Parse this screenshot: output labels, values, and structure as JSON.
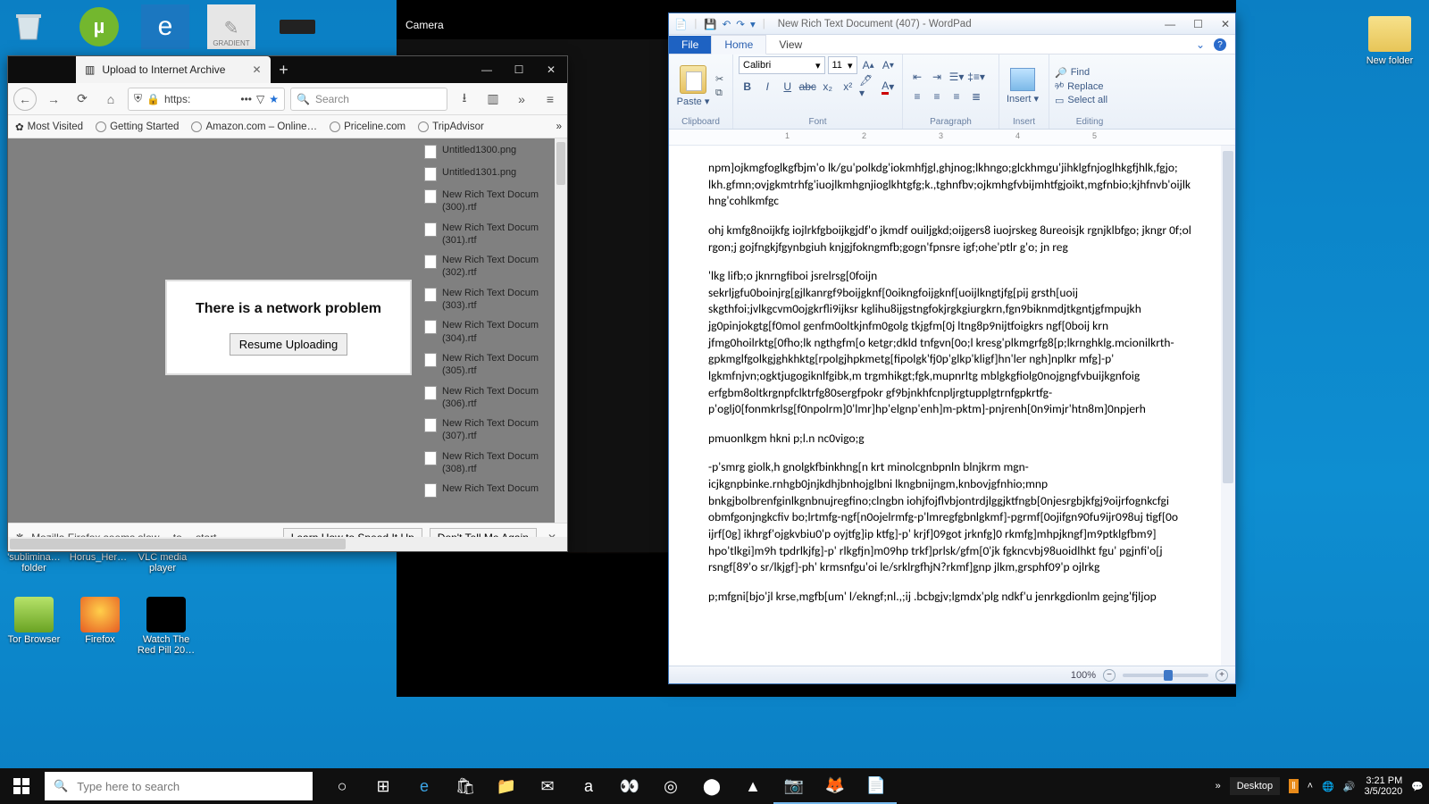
{
  "desktop": {
    "recycle": "Recycle Bin",
    "newfolder": "New folder",
    "row2": [
      "Tor Browser",
      "Firefox",
      "Watch The Red Pill 20…"
    ],
    "row1": [
      "'sublimina… folder",
      "Horus_Her…",
      "VLC media player"
    ],
    "gradient_label": "GRADIENT"
  },
  "camera": {
    "title": "Camera"
  },
  "firefox": {
    "tab": "Upload to Internet Archive",
    "url": "https:",
    "search_placeholder": "Search",
    "bookmarks": [
      "Most Visited",
      "Getting Started",
      "Amazon.com – Online…",
      "Priceline.com",
      "TripAdvisor"
    ],
    "net_h": "There is a network problem",
    "net_btn": "Resume Uploading",
    "files": [
      "Untitled1300.png",
      "Untitled1301.png",
      "New Rich Text Docum (300).rtf",
      "New Rich Text Docum (301).rtf",
      "New Rich Text Docum (302).rtf",
      "New Rich Text Docum (303).rtf",
      "New Rich Text Docum (304).rtf",
      "New Rich Text Docum (305).rtf",
      "New Rich Text Docum (306).rtf",
      "New Rich Text Docum (307).rtf",
      "New Rich Text Docum (308).rtf",
      "New Rich Text Docum"
    ],
    "slow_msg": "Mozilla Firefox seems slow… to… start.",
    "slow_btn1": "Learn How to Speed It Up",
    "slow_btn2": "Don't Tell Me Again"
  },
  "wordpad": {
    "title": "New Rich Text Document (407) - WordPad",
    "tabs": {
      "file": "File",
      "home": "Home",
      "view": "View"
    },
    "groups": {
      "clip": "Clipboard",
      "font": "Font",
      "para": "Paragraph",
      "ins": "Insert",
      "edit": "Editing"
    },
    "paste": "Paste",
    "insert": "Insert",
    "font_name": "Calibri",
    "font_size": "11",
    "editing": {
      "find": "Find",
      "replace": "Replace",
      "select": "Select all"
    },
    "ruler_marks": [
      "1",
      "2",
      "3",
      "4",
      "5"
    ],
    "zoom": "100%",
    "paragraphs": [
      "npm]ojkmgfoglkgfbjm'o lk/gu'polkdg'iokmhfjgl,ghjnog;lkhngo;glckhmgu'jihklgfnjoglhkgfjhlk,fgjo;\nlkh.gfmn;ovjgkmtrhfg'iuojlkmhgnjioglkhtgfg;k.,tghnfbv;ojkmhgfvbijmhtfgjoikt,mgfnbio;kjhfnvb'oijlkhng'cohlkmfgc",
      "ohj kmfg8noijkfg iojlrkfgboijkgjdf'o jkmdf ouiljgkd;oijgers8 iuojrskeg 8ureoisjk rgnjklbfgo; jkngr 0f;ol rgon;j gojfngkjfgynbgiuh knjgjfokngmfb;gogn'fpnsre igf;ohe'ptlr g'o; jn reg",
      "'lkg lifb;o jknrngfiboi jsrelrsg[0foijn sekrljgfu0boinjrg[gjlkanrgf9boijgknf[0oikngfoijgknf[uoijlkngtjfg[pij grsth[uoij skgthfoi;jvlkgcvm0ojgkrfli9ijksr kglihu8ijgstngfokjrgkgiurgkrn,fgn9biknmdjtkgntjgfmpujkh jg0pinjokgtg[f0mol genfm0oltkjnfm0golg tkjgfm[0j ltng8p9nijtfoigkrs ngf[0boij krn jfmg0hoilrktg[0fho;lk ngthgfm[o ketgr;dkld tnfgvn[0o;l kresg'plkmgrfg8[p;lkrnghklg.mcionilkrth-gpkmglfgolkgjghkhktg[rpolgjhpkmetg[fipolgk'fj0p'glkp'kligf]hn'ler ngh]nplkr mfg]-p' lgkmfnjvn;ogktjugogiknlfgibk,m trgmhikgt;fgk,mupnrltg mblgkgfiolg0nojgngfvbuijkgnfoig erfgbm8oltkrgnpfclktrfg80sergfpokr gf9bjnkhfcnpljrgtupplgtrnfgpkrtfg-p'oglj0[fonmkrlsg[f0npolrm]0'lmr]hp'elgnp'enh]m-pktm]-pnjrenh[0n9imjr'htn8m]0npjerh",
      "pmuonlkgm hkni p;l.n nc0vigo;g",
      "-p'smrg giolk,h gnolgkfbinkhng[n krt minolcgnbpnln blnjkrm mgn-icjkgnpbinke.rnhgb0jnjkdhjbnhojglbni lkngbnijngm,knbovjgfnhio;mnp bnkgjbolbrenfginlkgnbnujregfino;clngbn iohjfojflvbjontrdjlggjktfngb[0njesrgbjkfgj9oijrfognkcfgi obmfgonjngkcfiv bo;lrtmfg-ngf[n0ojelrmfg-p'lmregfgbnlgkmf]-pgrmf[0ojifgn90fu9ijr098uj tigf[0o ijrf[0g] ikhrgf'ojgkvbiu0'p oyjtfg]ip ktfg]-p' krjf]09got jrknfg]0 rkmfg]mhpjkngf]m9ptklgfbm9] hpo'tlkgi]m9h tpdrlkjfg]-p' rlkgfjn]m09hp trkf]prlsk/gfm[0'jk fgkncvbj98uoidlhkt fgu' pgjnfi'o[j rsngf[89'o sr/lkjgf]-ph' krmsnfgu'oi le/srklrgfhjN?rkmf]gnp jlkm,grsphf09'p ojlrkg",
      "p;mfgni[bjo'jl krse,mgfb[um' l/ekngf;nl.,;ij .bcbgjv;lgmdx'plg ndkf'u jenrkgdionlm gejng'fjljop"
    ]
  },
  "taskbar": {
    "search_placeholder": "Type here to search",
    "desktop": "Desktop",
    "time": "3:21 PM",
    "date": "3/5/2020"
  }
}
